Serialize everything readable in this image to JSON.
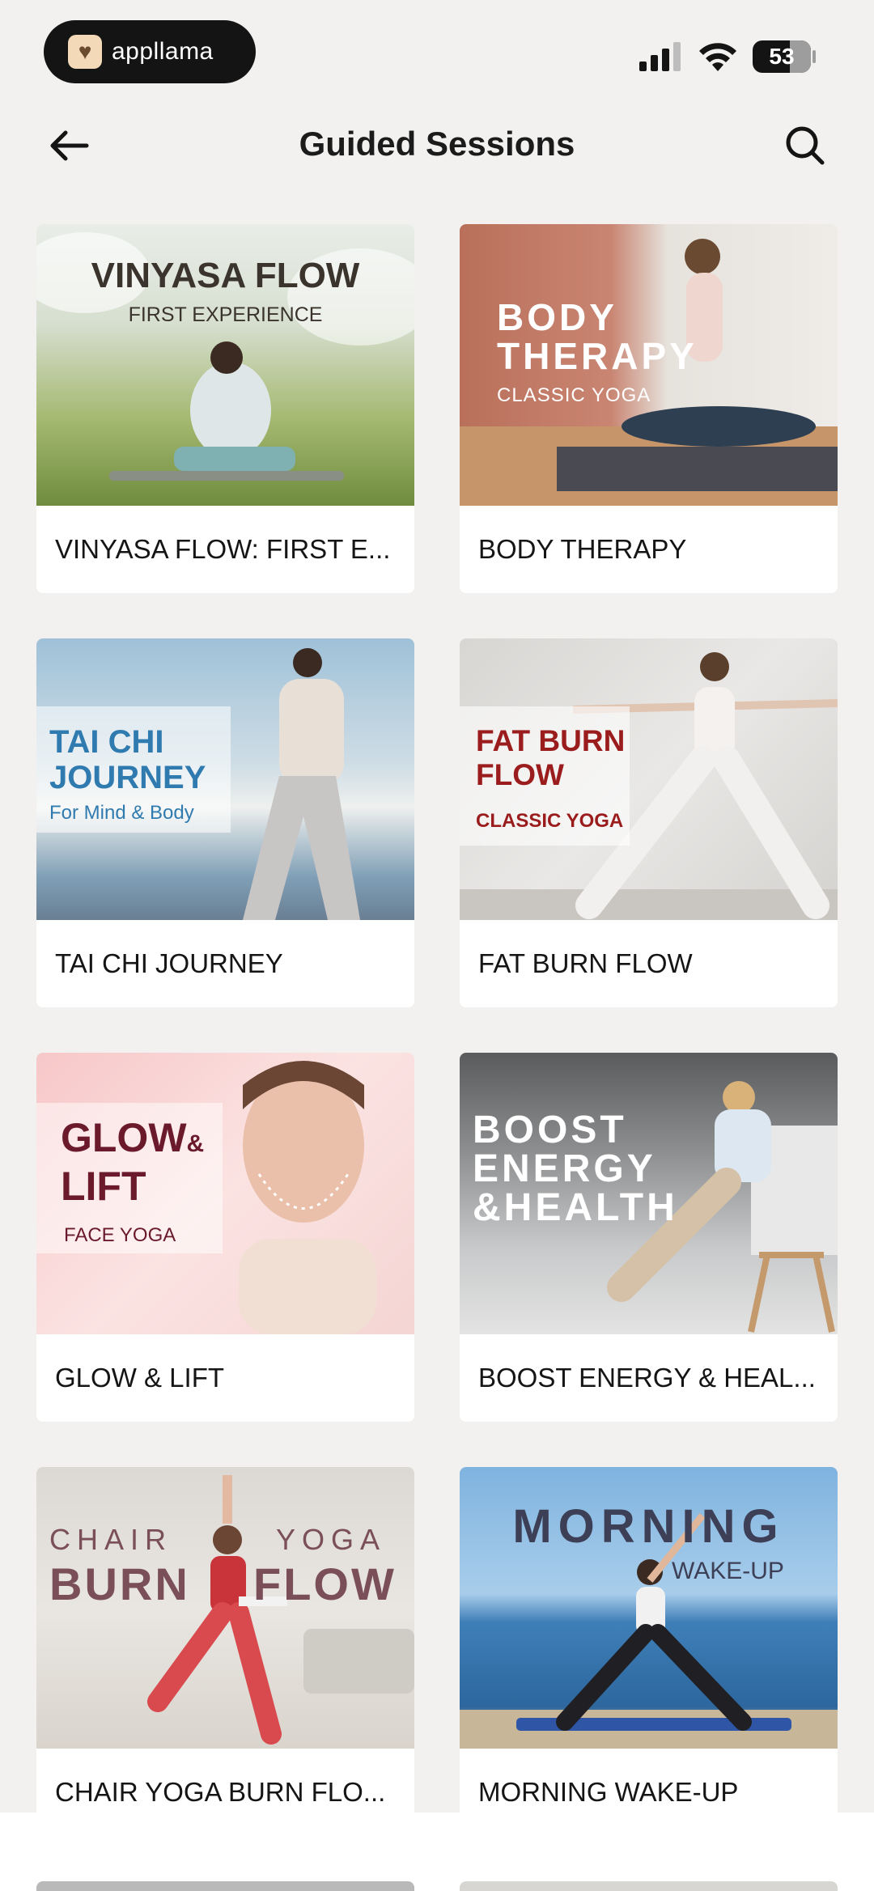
{
  "status_bar": {
    "app_name": "appllama",
    "battery": "53"
  },
  "header": {
    "title": "Guided Sessions",
    "back_icon": "arrow-left-icon",
    "search_icon": "search-icon"
  },
  "sessions": [
    {
      "label": "VINYASA FLOW: FIRST E...",
      "overlay_title": "VINYASA FLOW",
      "overlay_sub": "FIRST EXPERIENCE"
    },
    {
      "label": "BODY THERAPY",
      "overlay_title_1": "BODY",
      "overlay_title_2": "THERAPY",
      "overlay_sub": "CLASSIC YOGA"
    },
    {
      "label": "TAI CHI JOURNEY",
      "overlay_title_1": "TAI CHI",
      "overlay_title_2": "JOURNEY",
      "overlay_sub": "For Mind & Body"
    },
    {
      "label": "FAT BURN FLOW",
      "overlay_title_1": "FAT BURN",
      "overlay_title_2": "FLOW",
      "overlay_sub": "CLASSIC YOGA"
    },
    {
      "label": "GLOW & LIFT",
      "overlay_title_1": "GLOW",
      "overlay_amp": "&",
      "overlay_title_2": "LIFT",
      "overlay_sub": "FACE YOGA"
    },
    {
      "label": "BOOST ENERGY & HEAL...",
      "overlay_title_1": "BOOST",
      "overlay_title_2": "ENERGY",
      "overlay_title_3": "&HEALTH"
    },
    {
      "label": "CHAIR YOGA BURN FLO...",
      "overlay_a": "CHAIR",
      "overlay_b": "YOGA",
      "overlay_c": "BURN",
      "overlay_d": "FLOW"
    },
    {
      "label": "MORNING WAKE-UP",
      "overlay_title_1": "MORNING",
      "overlay_sub": "WAKE-UP"
    }
  ],
  "colors": {
    "background": "#f2f1ef",
    "card": "#ffffff",
    "text": "#151515"
  }
}
